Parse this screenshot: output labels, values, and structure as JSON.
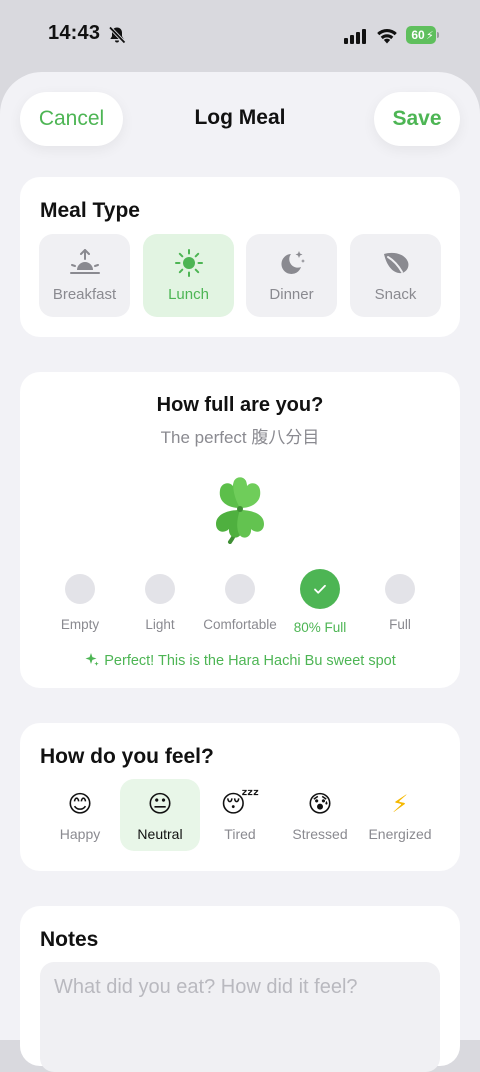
{
  "status": {
    "time": "14:43",
    "battery": "60"
  },
  "nav": {
    "cancel": "Cancel",
    "title": "Log Meal",
    "save": "Save"
  },
  "meal_type": {
    "title": "Meal Type",
    "options": [
      {
        "label": "Breakfast",
        "icon": "sunrise-icon"
      },
      {
        "label": "Lunch",
        "icon": "sun-icon",
        "selected": true
      },
      {
        "label": "Dinner",
        "icon": "moon-stars-icon"
      },
      {
        "label": "Snack",
        "icon": "leaf-icon"
      }
    ]
  },
  "fullness": {
    "title": "How full are you?",
    "subtitle": "The perfect 腹八分目",
    "icon": "four-leaf-clover-icon",
    "levels": [
      {
        "label": "Empty"
      },
      {
        "label": "Light"
      },
      {
        "label": "Comfortable"
      },
      {
        "label": "80% Full",
        "selected": true
      },
      {
        "label": "Full"
      }
    ],
    "message": "Perfect! This is the Hara Hachi Bu sweet spot"
  },
  "feel": {
    "title": "How do you feel?",
    "options": [
      {
        "label": "Happy",
        "emoji": "😊"
      },
      {
        "label": "Neutral",
        "emoji": "😐",
        "selected": true
      },
      {
        "label": "Tired",
        "emoji": "😴"
      },
      {
        "label": "Stressed",
        "emoji": "😰"
      },
      {
        "label": "Energized",
        "emoji": "⚡"
      }
    ]
  },
  "notes": {
    "title": "Notes",
    "placeholder": "What did you eat? How did it feel?",
    "value": ""
  },
  "colors": {
    "accent": "#4db554",
    "accent_bg": "#e2f4e2",
    "background": "#f2f2f6",
    "card": "#ffffff"
  }
}
